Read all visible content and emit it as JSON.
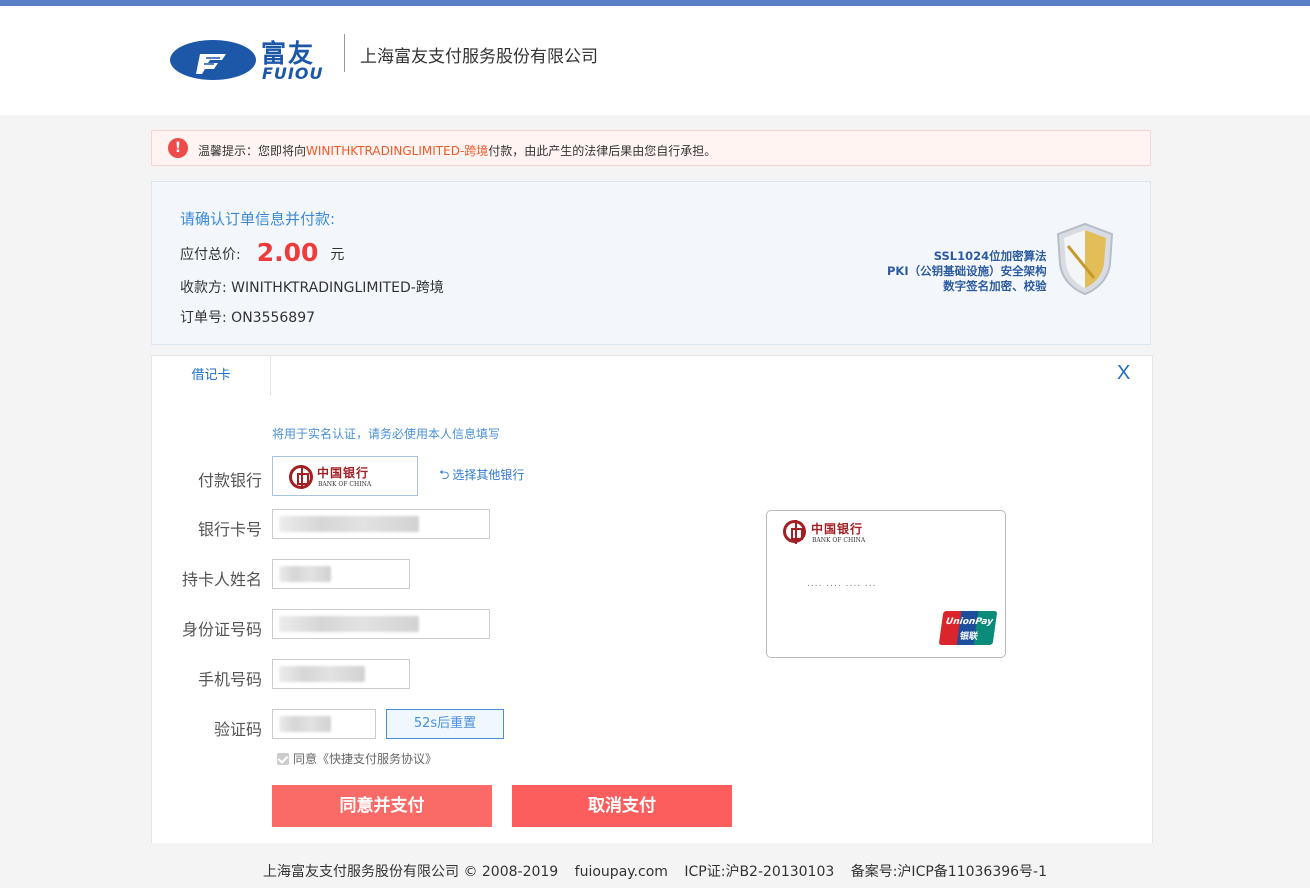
{
  "header": {
    "logo_cn": "富友",
    "logo_en": "FUIOU",
    "company_name": "上海富友支付服务股份有限公司"
  },
  "warning": {
    "prefix": "温馨提示：您即将向",
    "merchant": "WINITHKTRADINGLIMITED-跨境",
    "suffix": "付款，由此产生的法律后果由您自行承担。"
  },
  "order": {
    "title": "请确认订单信息并付款:",
    "amount_label": "应付总价:",
    "amount": "2.00",
    "currency": "元",
    "payee_label": "收款方:",
    "payee": "WINITHKTRADINGLIMITED-跨境",
    "order_no_label": "订单号:",
    "order_no": "ON3556897",
    "ssl_lines": [
      "SSL1024位加密算法",
      "PKI（公钥基础设施）安全架构",
      "数字签名加密、校验"
    ]
  },
  "panel": {
    "tab_label": "借记卡",
    "close_label": "X",
    "hint": "将用于实名认证，请务必使用本人信息填写",
    "bank_label": "付款银行",
    "bank_name_cn": "中国银行",
    "bank_name_en": "BANK OF CHINA",
    "other_bank": "选择其他银行",
    "card_no_label": "银行卡号",
    "holder_label": "持卡人姓名",
    "id_label": "身份证号码",
    "phone_label": "手机号码",
    "code_label": "验证码",
    "countdown": "52s后重置",
    "agree_text": "同意《快捷支付服务协议》",
    "confirm_btn": "同意并支付",
    "cancel_btn": "取消支付",
    "card_preview_number": ".... .... .... ...",
    "unionpay_en": "UnionPay",
    "unionpay_cn": "银联"
  },
  "footer": {
    "copyright": "上海富友支付服务股份有限公司 © 2008-2019",
    "domain": "fuioupay.com",
    "icp_cert": "ICP证:沪B2-20130103",
    "record": "备案号:沪ICP备11036396号-1"
  },
  "colors": {
    "brand_blue": "#1d57a8",
    "accent_red": "#ee3b3b",
    "button_red": "#fa6a67",
    "link_blue": "#2d7bd0"
  }
}
